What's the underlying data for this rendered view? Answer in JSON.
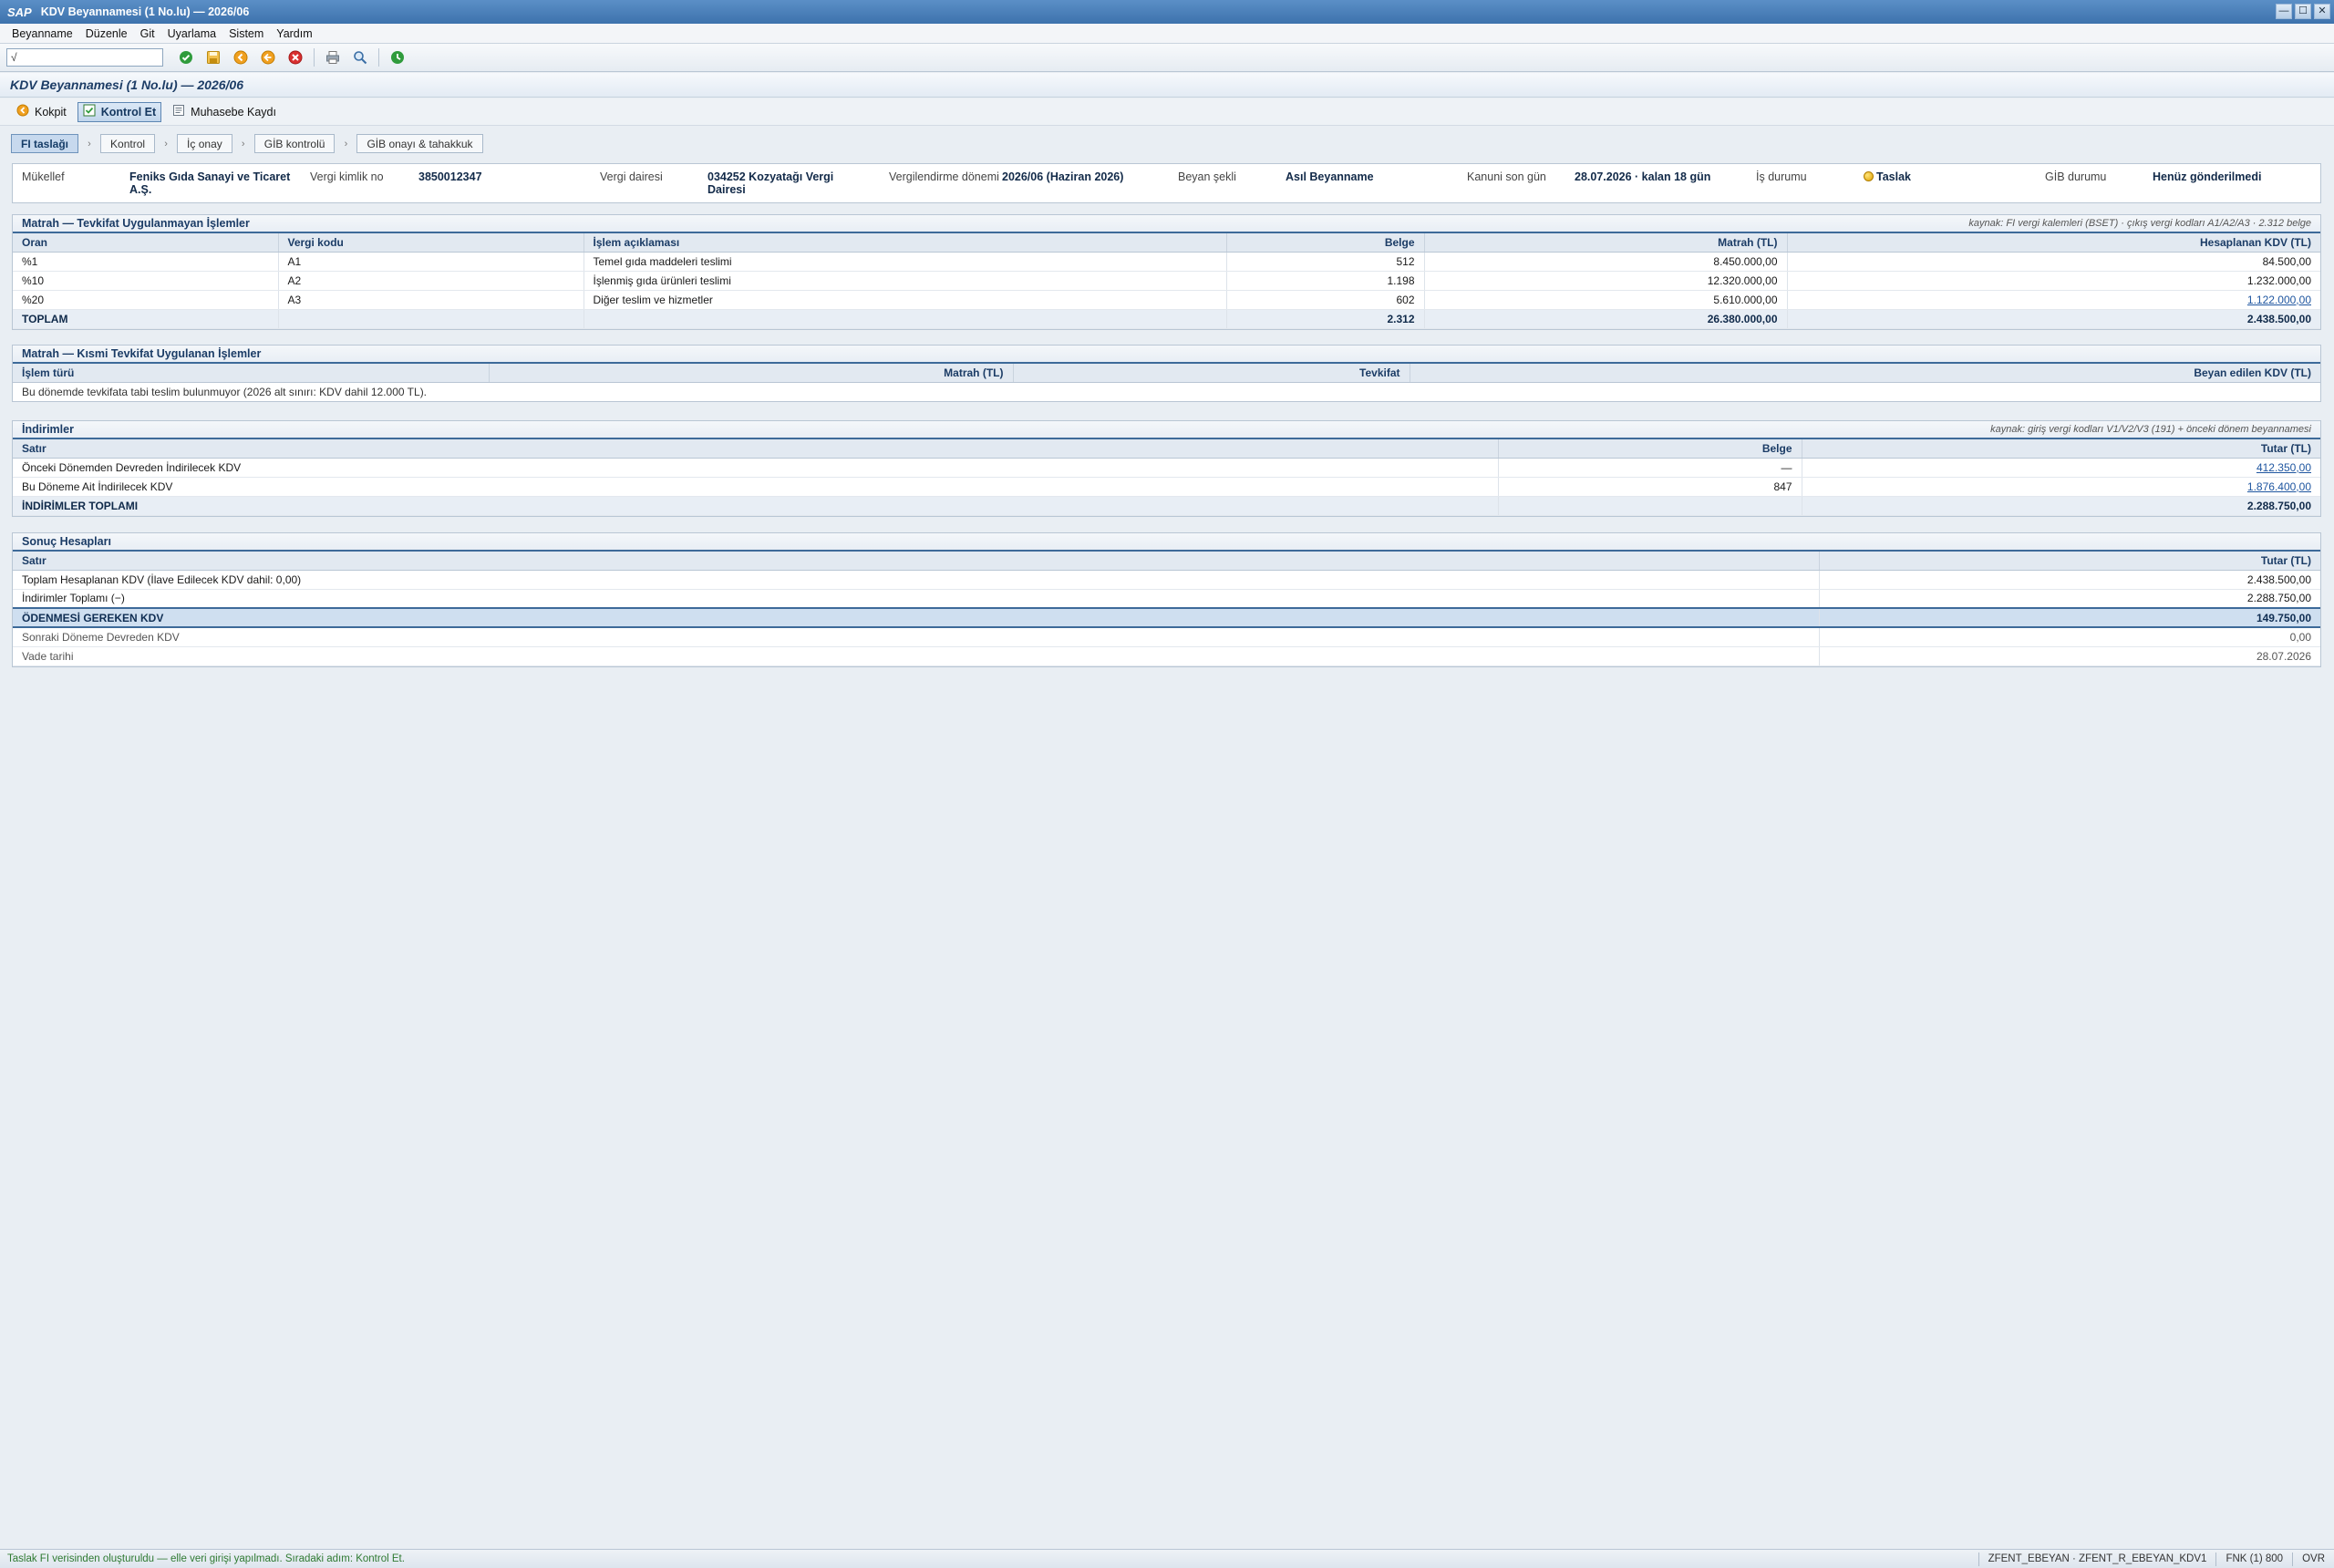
{
  "window": {
    "brand": "SAP",
    "title": "KDV Beyannamesi (1 No.lu) — 2026/06",
    "controls": [
      "—",
      "☐",
      "✕"
    ]
  },
  "menu": [
    "Beyanname",
    "Düzenle",
    "Git",
    "Uyarlama",
    "Sistem",
    "Yardım"
  ],
  "toolbar": {
    "command_value": "√",
    "icons": [
      "enter-icon",
      "save-icon",
      "back-icon",
      "exit-icon",
      "cancel-icon",
      "print-icon",
      "find-icon",
      "history-icon"
    ]
  },
  "page_title": "KDV Beyannamesi (1 No.lu) — 2026/06",
  "app_toolbar": {
    "kokpit": "Kokpit",
    "kontrol_et": "Kontrol Et",
    "muhasebe": "Muhasebe Kaydı"
  },
  "steps": [
    "FI taslağı",
    "Kontrol",
    "İç onay",
    "GİB kontrolü",
    "GİB onayı & tahakkuk"
  ],
  "header": {
    "mukellef_label": "Mükellef",
    "mukellef_value": "Feniks Gıda Sanayi ve Ticaret A.Ş.",
    "vkn_label": "Vergi kimlik no",
    "vkn_value": "3850012347",
    "vd_label": "Vergi dairesi",
    "vd_value": "034252 Kozyatağı Vergi Dairesi",
    "donem_label": "Vergilendirme dönemi",
    "donem_value": "2026/06 (Haziran 2026)",
    "beyan_label": "Beyan şekli",
    "beyan_value": "Asıl Beyanname",
    "songun_label": "Kanuni son gün",
    "songun_value": "28.07.2026 · kalan 18 gün",
    "is_label": "İş durumu",
    "is_value": "Taslak",
    "gib_label": "GİB durumu",
    "gib_value": "Henüz gönderilmedi"
  },
  "matrah1": {
    "title": "Matrah — Tevkifat Uygulanmayan İşlemler",
    "source": "kaynak: FI vergi kalemleri (BSET) · çıkış vergi kodları A1/A2/A3 · 2.312 belge",
    "columns": [
      "Oran",
      "Vergi kodu",
      "İşlem açıklaması",
      "Belge",
      "Matrah (TL)",
      "Hesaplanan KDV (TL)"
    ],
    "rows": [
      {
        "oran": "%1",
        "kod": "A1",
        "aciklama": "Temel gıda maddeleri teslimi",
        "belge": "512",
        "matrah": "8.450.000,00",
        "kdv": "84.500,00"
      },
      {
        "oran": "%10",
        "kod": "A2",
        "aciklama": "İşlenmiş gıda ürünleri teslimi",
        "belge": "1.198",
        "matrah": "12.320.000,00",
        "kdv": "1.232.000,00"
      },
      {
        "oran": "%20",
        "kod": "A3",
        "aciklama": "Diğer teslim ve hizmetler",
        "belge": "602",
        "matrah": "5.610.000,00",
        "kdv": "1.122.000,00"
      }
    ],
    "total": {
      "label": "TOPLAM",
      "belge": "2.312",
      "matrah": "26.380.000,00",
      "kdv": "2.438.500,00"
    }
  },
  "matrah2": {
    "title": "Matrah — Kısmi Tevkifat Uygulanan İşlemler",
    "columns": [
      "İşlem türü",
      "Matrah (TL)",
      "Tevkifat",
      "Beyan edilen KDV (TL)"
    ],
    "note": "Bu dönemde tevkifata tabi teslim bulunmuyor (2026 alt sınırı: KDV dahil 12.000 TL)."
  },
  "indirimler": {
    "title": "İndirimler",
    "source": "kaynak: giriş vergi kodları V1/V2/V3 (191) + önceki dönem beyannamesi",
    "columns": [
      "Satır",
      "Belge",
      "Tutar (TL)"
    ],
    "rows": [
      {
        "satir": "Önceki Dönemden Devreden İndirilecek KDV",
        "belge": "—",
        "tutar": "412.350,00"
      },
      {
        "satir": "Bu Döneme Ait İndirilecek KDV",
        "belge": "847",
        "tutar": "1.876.400,00"
      }
    ],
    "total": {
      "label": "İNDİRİMLER TOPLAMI",
      "tutar": "2.288.750,00"
    }
  },
  "sonuc": {
    "title": "Sonuç Hesapları",
    "columns": [
      "Satır",
      "Tutar (TL)"
    ],
    "rows": [
      {
        "satir": "Toplam Hesaplanan KDV (İlave Edilecek KDV dahil: 0,00)",
        "tutar": "2.438.500,00"
      },
      {
        "satir": "İndirimler Toplamı (−)",
        "tutar": "2.288.750,00"
      }
    ],
    "odenecek": {
      "label": "ÖDENMESİ GEREKEN KDV",
      "tutar": "149.750,00"
    },
    "after": [
      {
        "satir": "Sonraki Döneme Devreden KDV",
        "tutar": "0,00"
      },
      {
        "satir": "Vade tarihi",
        "tutar": "28.07.2026"
      }
    ]
  },
  "statusbar": {
    "message": "Taslak FI verisinden oluşturuldu — elle veri girişi yapılmadı. Sıradaki adım: Kontrol Et.",
    "program": "ZFENT_EBEYAN · ZFENT_R_EBEYAN_KDV1",
    "system": "FNK (1) 800",
    "mode": "OVR"
  }
}
